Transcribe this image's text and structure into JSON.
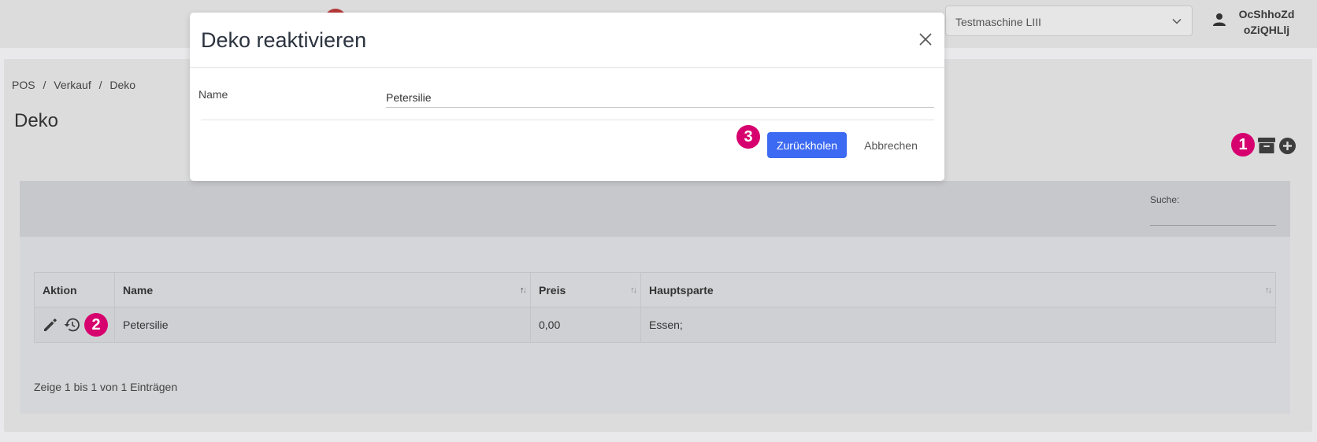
{
  "topbar": {
    "machine_select_value": "Testmaschine LIII",
    "user_line1": "OcShhoZd",
    "user_line2": "oZiQHLlj"
  },
  "breadcrumb": [
    "POS",
    "/",
    "Verkauf",
    "/",
    "Deko"
  ],
  "page_title": "Deko",
  "markers": {
    "toolbar": "1",
    "row": "2",
    "modal": "3"
  },
  "search": {
    "label": "Suche:"
  },
  "table": {
    "headers": [
      "Aktion",
      "Name",
      "Preis",
      "Hauptsparte"
    ],
    "rows": [
      {
        "name": "Petersilie",
        "price": "0,00",
        "division": "Essen;"
      }
    ]
  },
  "table_info": "Zeige 1 bis 1 von 1 Einträgen",
  "modal": {
    "title": "Deko reaktivieren",
    "name_label": "Name",
    "name_value": "Petersilie",
    "confirm_label": "Zurückholen",
    "cancel_label": "Abbrechen"
  },
  "colors": {
    "marker": "#d6006e",
    "primary_button": "#3d6af2"
  },
  "icons": [
    "chevron-down-icon",
    "user-icon",
    "archive-icon",
    "plus-circle-icon",
    "pencil-icon",
    "restore-icon",
    "close-icon"
  ]
}
